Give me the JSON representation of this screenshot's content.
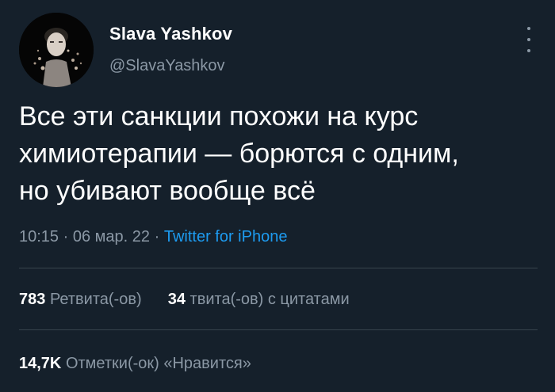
{
  "author": {
    "name": "Slava Yashkov",
    "handle": "@SlavaYashkov",
    "avatar_icon": "profile-photo"
  },
  "tweet": {
    "text": "Все эти санкции похожи на курс\nхимиотерапии — борются с одним,\nно убивают вообще всё",
    "time": "10:15",
    "separator": "·",
    "date": "06 мар. 22",
    "source": "Twitter for iPhone"
  },
  "stats": {
    "retweets_count": "783",
    "retweets_label": "Ретвита(-ов)",
    "quotes_count": "34",
    "quotes_label": "твита(-ов) с цитатами",
    "likes_count": "14,7K",
    "likes_label": "Отметки(-ок) «Нравится»"
  },
  "colors": {
    "background": "#15202b",
    "text_primary": "#ffffff",
    "text_secondary": "#8b98a5",
    "link": "#1d9bf0",
    "divider": "#38444d"
  },
  "icons": {
    "more": "more-vertical-icon"
  }
}
